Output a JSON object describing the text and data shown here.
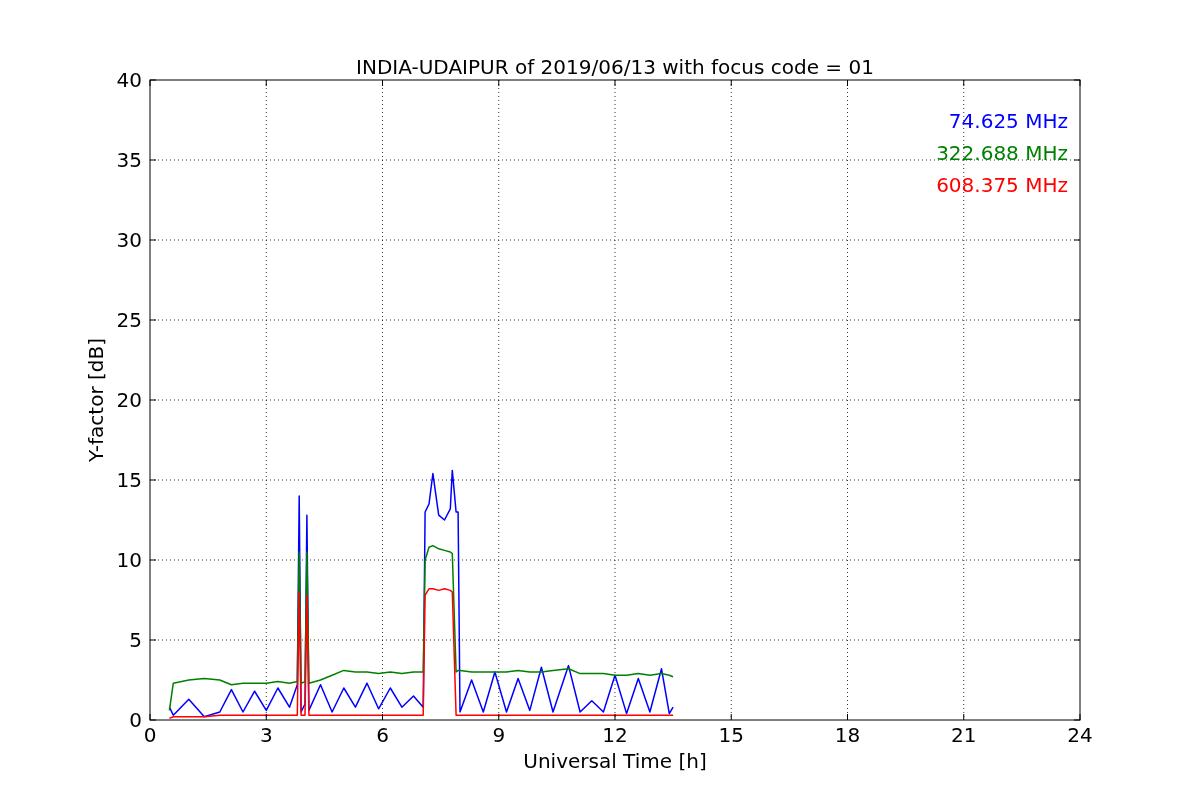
{
  "figure": {
    "chart_data": {
      "type": "line",
      "grid": true,
      "title": "INDIA-UDAIPUR of 2019/06/13 with focus code = 01",
      "xlabel": "Universal Time [h]",
      "ylabel": "Y-factor [dB]",
      "xlim": [
        0,
        24
      ],
      "ylim": [
        0,
        40
      ],
      "xticks": [
        0,
        3,
        6,
        9,
        12,
        15,
        18,
        21,
        24
      ],
      "yticks": [
        0,
        5,
        10,
        15,
        20,
        25,
        30,
        35,
        40
      ],
      "x": [
        0.5,
        0.6,
        1.0,
        1.4,
        1.8,
        2.1,
        2.4,
        2.7,
        3.0,
        3.3,
        3.6,
        3.8,
        3.85,
        3.9,
        4.0,
        4.05,
        4.1,
        4.4,
        4.7,
        5.0,
        5.3,
        5.6,
        5.9,
        6.2,
        6.5,
        6.8,
        7.05,
        7.1,
        7.2,
        7.3,
        7.45,
        7.6,
        7.75,
        7.8,
        7.9,
        7.95,
        8.0,
        8.3,
        8.6,
        8.9,
        9.2,
        9.5,
        9.8,
        10.1,
        10.4,
        10.8,
        11.1,
        11.4,
        11.7,
        12.0,
        12.3,
        12.6,
        12.9,
        13.2,
        13.4,
        13.5
      ],
      "series": [
        {
          "name": "74.625 MHz",
          "color": "#0000ff",
          "values": [
            0.8,
            0.3,
            1.3,
            0.2,
            0.5,
            1.9,
            0.5,
            1.8,
            0.6,
            2.0,
            0.8,
            2.2,
            14.0,
            0.5,
            1.0,
            12.8,
            0.6,
            2.2,
            0.5,
            2.0,
            0.8,
            2.3,
            0.7,
            2.0,
            0.8,
            1.5,
            0.8,
            13.0,
            13.5,
            15.4,
            12.8,
            12.5,
            13.2,
            15.6,
            13.0,
            13.0,
            0.5,
            2.5,
            0.5,
            3.0,
            0.5,
            2.6,
            0.6,
            3.3,
            0.5,
            3.4,
            0.5,
            1.2,
            0.5,
            2.8,
            0.4,
            2.6,
            0.5,
            3.2,
            0.4,
            0.8
          ]
        },
        {
          "name": "322.688 MHz",
          "color": "#008000",
          "values": [
            0.6,
            2.3,
            2.5,
            2.6,
            2.5,
            2.2,
            2.3,
            2.3,
            2.3,
            2.4,
            2.3,
            2.4,
            10.5,
            2.3,
            2.4,
            10.5,
            2.3,
            2.5,
            2.8,
            3.1,
            3.0,
            3.0,
            2.9,
            3.0,
            2.9,
            3.0,
            3.0,
            10.0,
            10.8,
            10.9,
            10.7,
            10.6,
            10.5,
            10.4,
            3.0,
            3.1,
            3.1,
            3.0,
            3.0,
            3.0,
            3.0,
            3.1,
            3.0,
            3.0,
            3.1,
            3.2,
            2.9,
            2.9,
            2.9,
            2.8,
            2.8,
            2.9,
            2.8,
            2.9,
            2.8,
            2.7
          ]
        },
        {
          "name": "608.375 MHz",
          "color": "#ff0000",
          "values": [
            0.1,
            0.2,
            0.2,
            0.2,
            0.3,
            0.3,
            0.3,
            0.3,
            0.3,
            0.3,
            0.3,
            0.3,
            8.0,
            0.3,
            0.3,
            7.8,
            0.3,
            0.3,
            0.3,
            0.3,
            0.3,
            0.3,
            0.3,
            0.3,
            0.3,
            0.3,
            0.3,
            7.8,
            8.2,
            8.2,
            8.1,
            8.2,
            8.1,
            8.0,
            0.3,
            0.3,
            0.3,
            0.3,
            0.3,
            0.3,
            0.3,
            0.3,
            0.3,
            0.3,
            0.3,
            0.3,
            0.3,
            0.3,
            0.3,
            0.3,
            0.3,
            0.3,
            0.3,
            0.3,
            0.3,
            0.3
          ]
        }
      ]
    }
  }
}
